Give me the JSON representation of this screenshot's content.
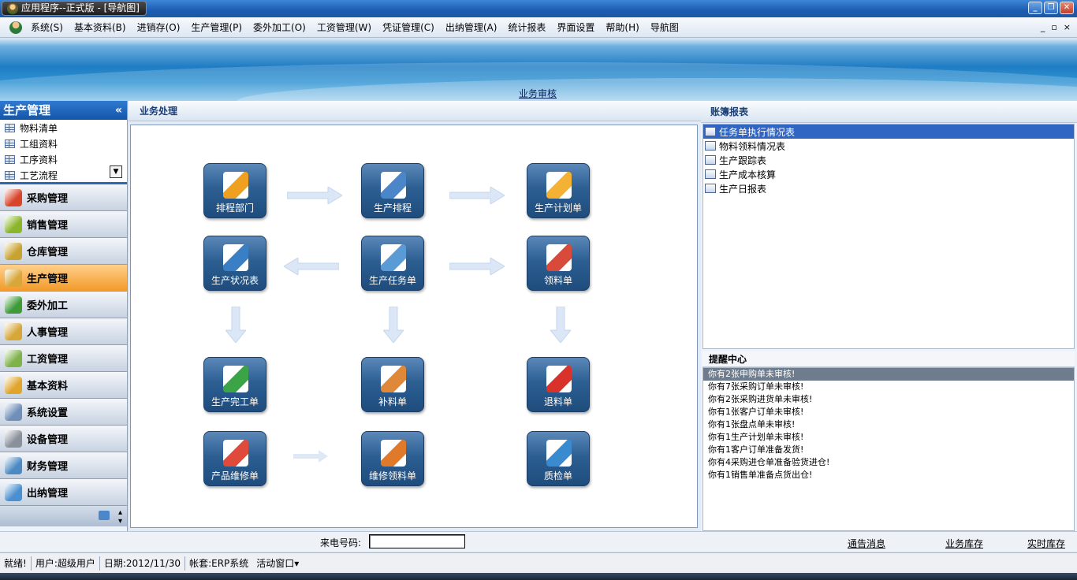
{
  "window": {
    "title": "应用程序--正式版 - [导航图]",
    "controls": [
      "minimize",
      "restore",
      "close"
    ]
  },
  "menu": {
    "items": [
      "系统(S)",
      "基本资料(B)",
      "进销存(O)",
      "生产管理(P)",
      "委外加工(O)",
      "工资管理(W)",
      "凭证管理(C)",
      "出纳管理(A)",
      "统计报表",
      "界面设置",
      "帮助(H)",
      "导航图"
    ],
    "right_controls": [
      "_",
      "▫",
      "×"
    ]
  },
  "banner": {
    "link": "业务审核"
  },
  "left": {
    "header": "生产管理",
    "collapse": "«",
    "sub_items": [
      "物料清单",
      "工组资料",
      "工序资料",
      "工艺流程"
    ],
    "modules": [
      {
        "label": "采购管理",
        "color": "#d9442b"
      },
      {
        "label": "销售管理",
        "color": "#8bb52b"
      },
      {
        "label": "仓库管理",
        "color": "#c9a332"
      },
      {
        "label": "生产管理",
        "color": "#d7a73a"
      },
      {
        "label": "委外加工",
        "color": "#3f9b3a"
      },
      {
        "label": "人事管理",
        "color": "#d6a638"
      },
      {
        "label": "工资管理",
        "color": "#7fb24a"
      },
      {
        "label": "基本资料",
        "color": "#e0a52c"
      },
      {
        "label": "系统设置",
        "color": "#6f8fb8"
      },
      {
        "label": "设备管理",
        "color": "#8a8f99"
      },
      {
        "label": "财务管理",
        "color": "#4d8ac4"
      },
      {
        "label": "出纳管理",
        "color": "#4a8fcf"
      }
    ],
    "active_module": "生产管理"
  },
  "center": {
    "header": "业务处理",
    "nodes": [
      "排程部门",
      "生产排程",
      "生产计划单",
      "生产状况表",
      "生产任务单",
      "领料单",
      "生产完工单",
      "补料单",
      "退料单",
      "产品维修单",
      "维修领料单",
      "质检单"
    ]
  },
  "right": {
    "reports_header": "账簿报表",
    "reports": [
      "任务单执行情况表",
      "物料领料情况表",
      "生产跟踪表",
      "生产成本核算",
      "生产日报表"
    ],
    "remind_header": "提醒中心",
    "reminders": [
      "你有2张申购单未审核!",
      "你有7张采购订单未审核!",
      "你有2张采购进货单未审核!",
      "你有1张客户订单未审核!",
      "你有1张盘点单未审核!",
      "你有1生产计划单未审核!",
      "你有1客户订单准备发货!",
      "你有4采购进仓单准备验货进仓!",
      "你有1销售单准备点货出仓!"
    ]
  },
  "bottom": {
    "phone_label": "来电号码:",
    "phone_value": "",
    "links": [
      "通告消息",
      "业务库存",
      "实时库存"
    ]
  },
  "status": {
    "ready": "就绪!",
    "user": "用户:超级用户",
    "date": "日期:2012/11/30",
    "account": "帐套:ERP系统",
    "window": "活动窗口▾"
  }
}
